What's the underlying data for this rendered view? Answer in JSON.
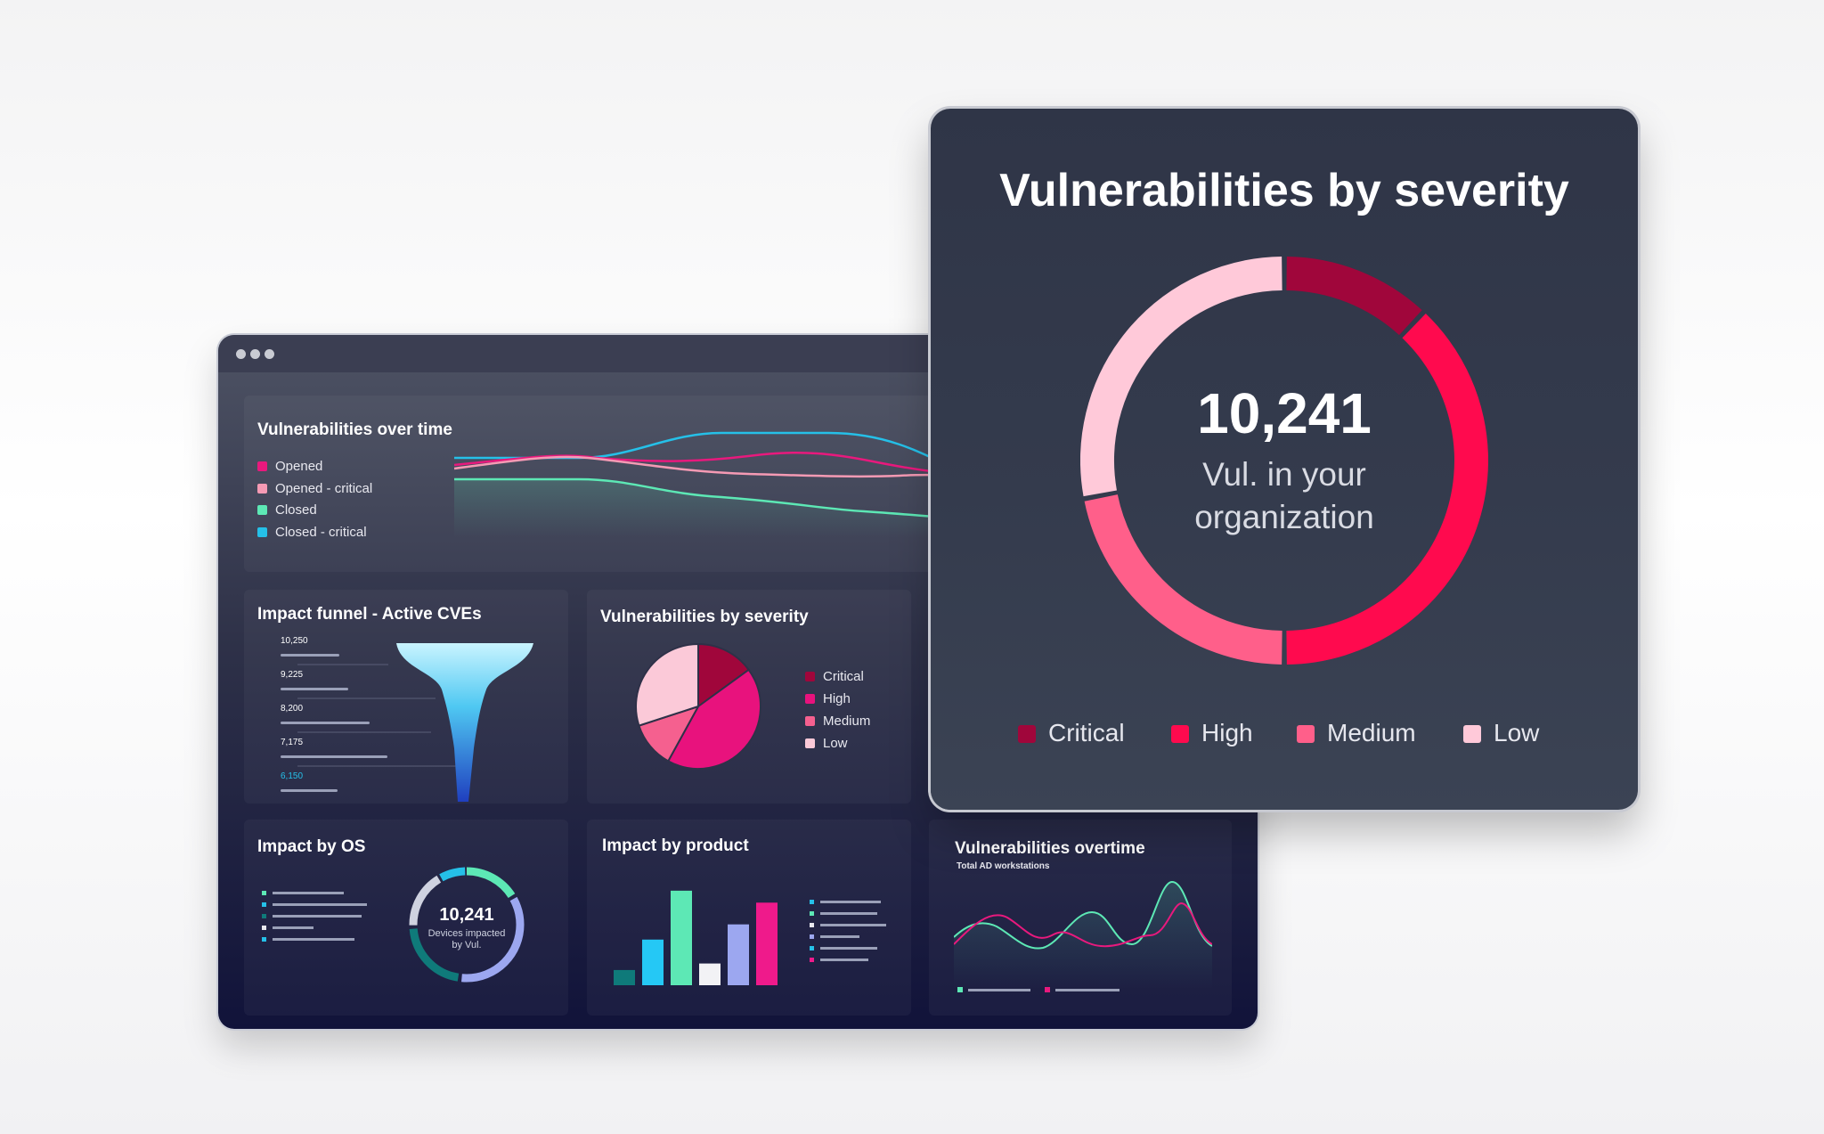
{
  "window": {
    "controls": [
      "close",
      "minimize",
      "maximize"
    ]
  },
  "panels": {
    "over_time": {
      "title": "Vulnerabilities over time",
      "legend": [
        {
          "label": "Opened",
          "color": "#e8197d"
        },
        {
          "label": "Opened - critical",
          "color": "#f59ab4"
        },
        {
          "label": "Closed",
          "color": "#5de8b5"
        },
        {
          "label": "Closed - critical",
          "color": "#25c0e8"
        }
      ]
    },
    "funnel": {
      "title": "Impact funnel - Active CVEs",
      "levels": [
        {
          "label": "10,250",
          "value": 10250
        },
        {
          "label": "9,225",
          "value": 9225
        },
        {
          "label": "8,200",
          "value": 8200
        },
        {
          "label": "7,175",
          "value": 7175
        },
        {
          "label": "6,150",
          "value": 6150
        }
      ]
    },
    "severity_small": {
      "title": "Vulnerabilities by severity",
      "legend": [
        {
          "label": "Critical",
          "color": "#a0063b"
        },
        {
          "label": "High",
          "color": "#e8127d"
        },
        {
          "label": "Medium",
          "color": "#f5608f"
        },
        {
          "label": "Low",
          "color": "#fbc9d8"
        }
      ]
    },
    "os": {
      "title": "Impact by OS",
      "donut_value": "10,241",
      "donut_caption_1": "Devices impacted",
      "donut_caption_2": "by Vul."
    },
    "product": {
      "title": "Impact by product"
    },
    "overtime2": {
      "title": "Vulnerabilities overtime",
      "subtitle": "Total AD workstations"
    }
  },
  "big_card": {
    "title": "Vulnerabilities by severity",
    "center_value": "10,241",
    "center_line1": "Vul. in your",
    "center_line2": "organization",
    "legend": [
      {
        "label": "Critical",
        "color": "#a0063b"
      },
      {
        "label": "High",
        "color": "#ff0a4e"
      },
      {
        "label": "Medium",
        "color": "#ff5f8a"
      },
      {
        "label": "Low",
        "color": "#ffc9d9"
      }
    ]
  },
  "chart_data": [
    {
      "type": "pie",
      "categories": [
        "Critical",
        "High",
        "Medium",
        "Low"
      ],
      "values": [
        15,
        43,
        12,
        30
      ]
    },
    {
      "type": "pie",
      "categories": [
        "Critical",
        "High",
        "Medium",
        "Low"
      ],
      "values": [
        12,
        38,
        22,
        28
      ],
      "center_label": "10,241"
    },
    {
      "type": "bar",
      "categories": [
        "",
        "",
        "",
        "",
        "",
        ""
      ],
      "values": [
        14,
        42,
        87,
        20,
        56,
        76
      ],
      "colors": [
        "#0f7a7a",
        "#25c8f5",
        "#5de8b5",
        "#f2f2f5",
        "#9ca7f0",
        "#ef1a8b"
      ]
    }
  ]
}
